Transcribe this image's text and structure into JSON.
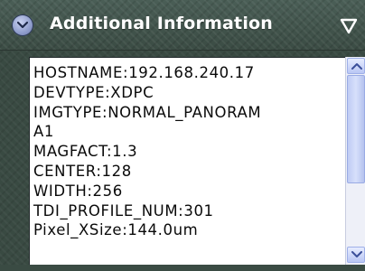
{
  "panel": {
    "title": "Additional Information",
    "collapse_icon": "chevron-down-circle-icon",
    "menu_icon": "triangle-down-icon"
  },
  "info_lines": [
    "HOSTNAME:192.168.240.17",
    "DEVTYPE:XDPC",
    "IMGTYPE:NORMAL_PANORAM",
    "A1",
    "MAGFACT:1.3",
    "CENTER:128",
    "WIDTH:256",
    "TDI_PROFILE_NUM:301",
    "Pixel_XSize:144.0um"
  ],
  "colors": {
    "panel_bg": "#394a42",
    "title_text": "#ffffff",
    "scroll_accent": "#b9c6f4"
  }
}
